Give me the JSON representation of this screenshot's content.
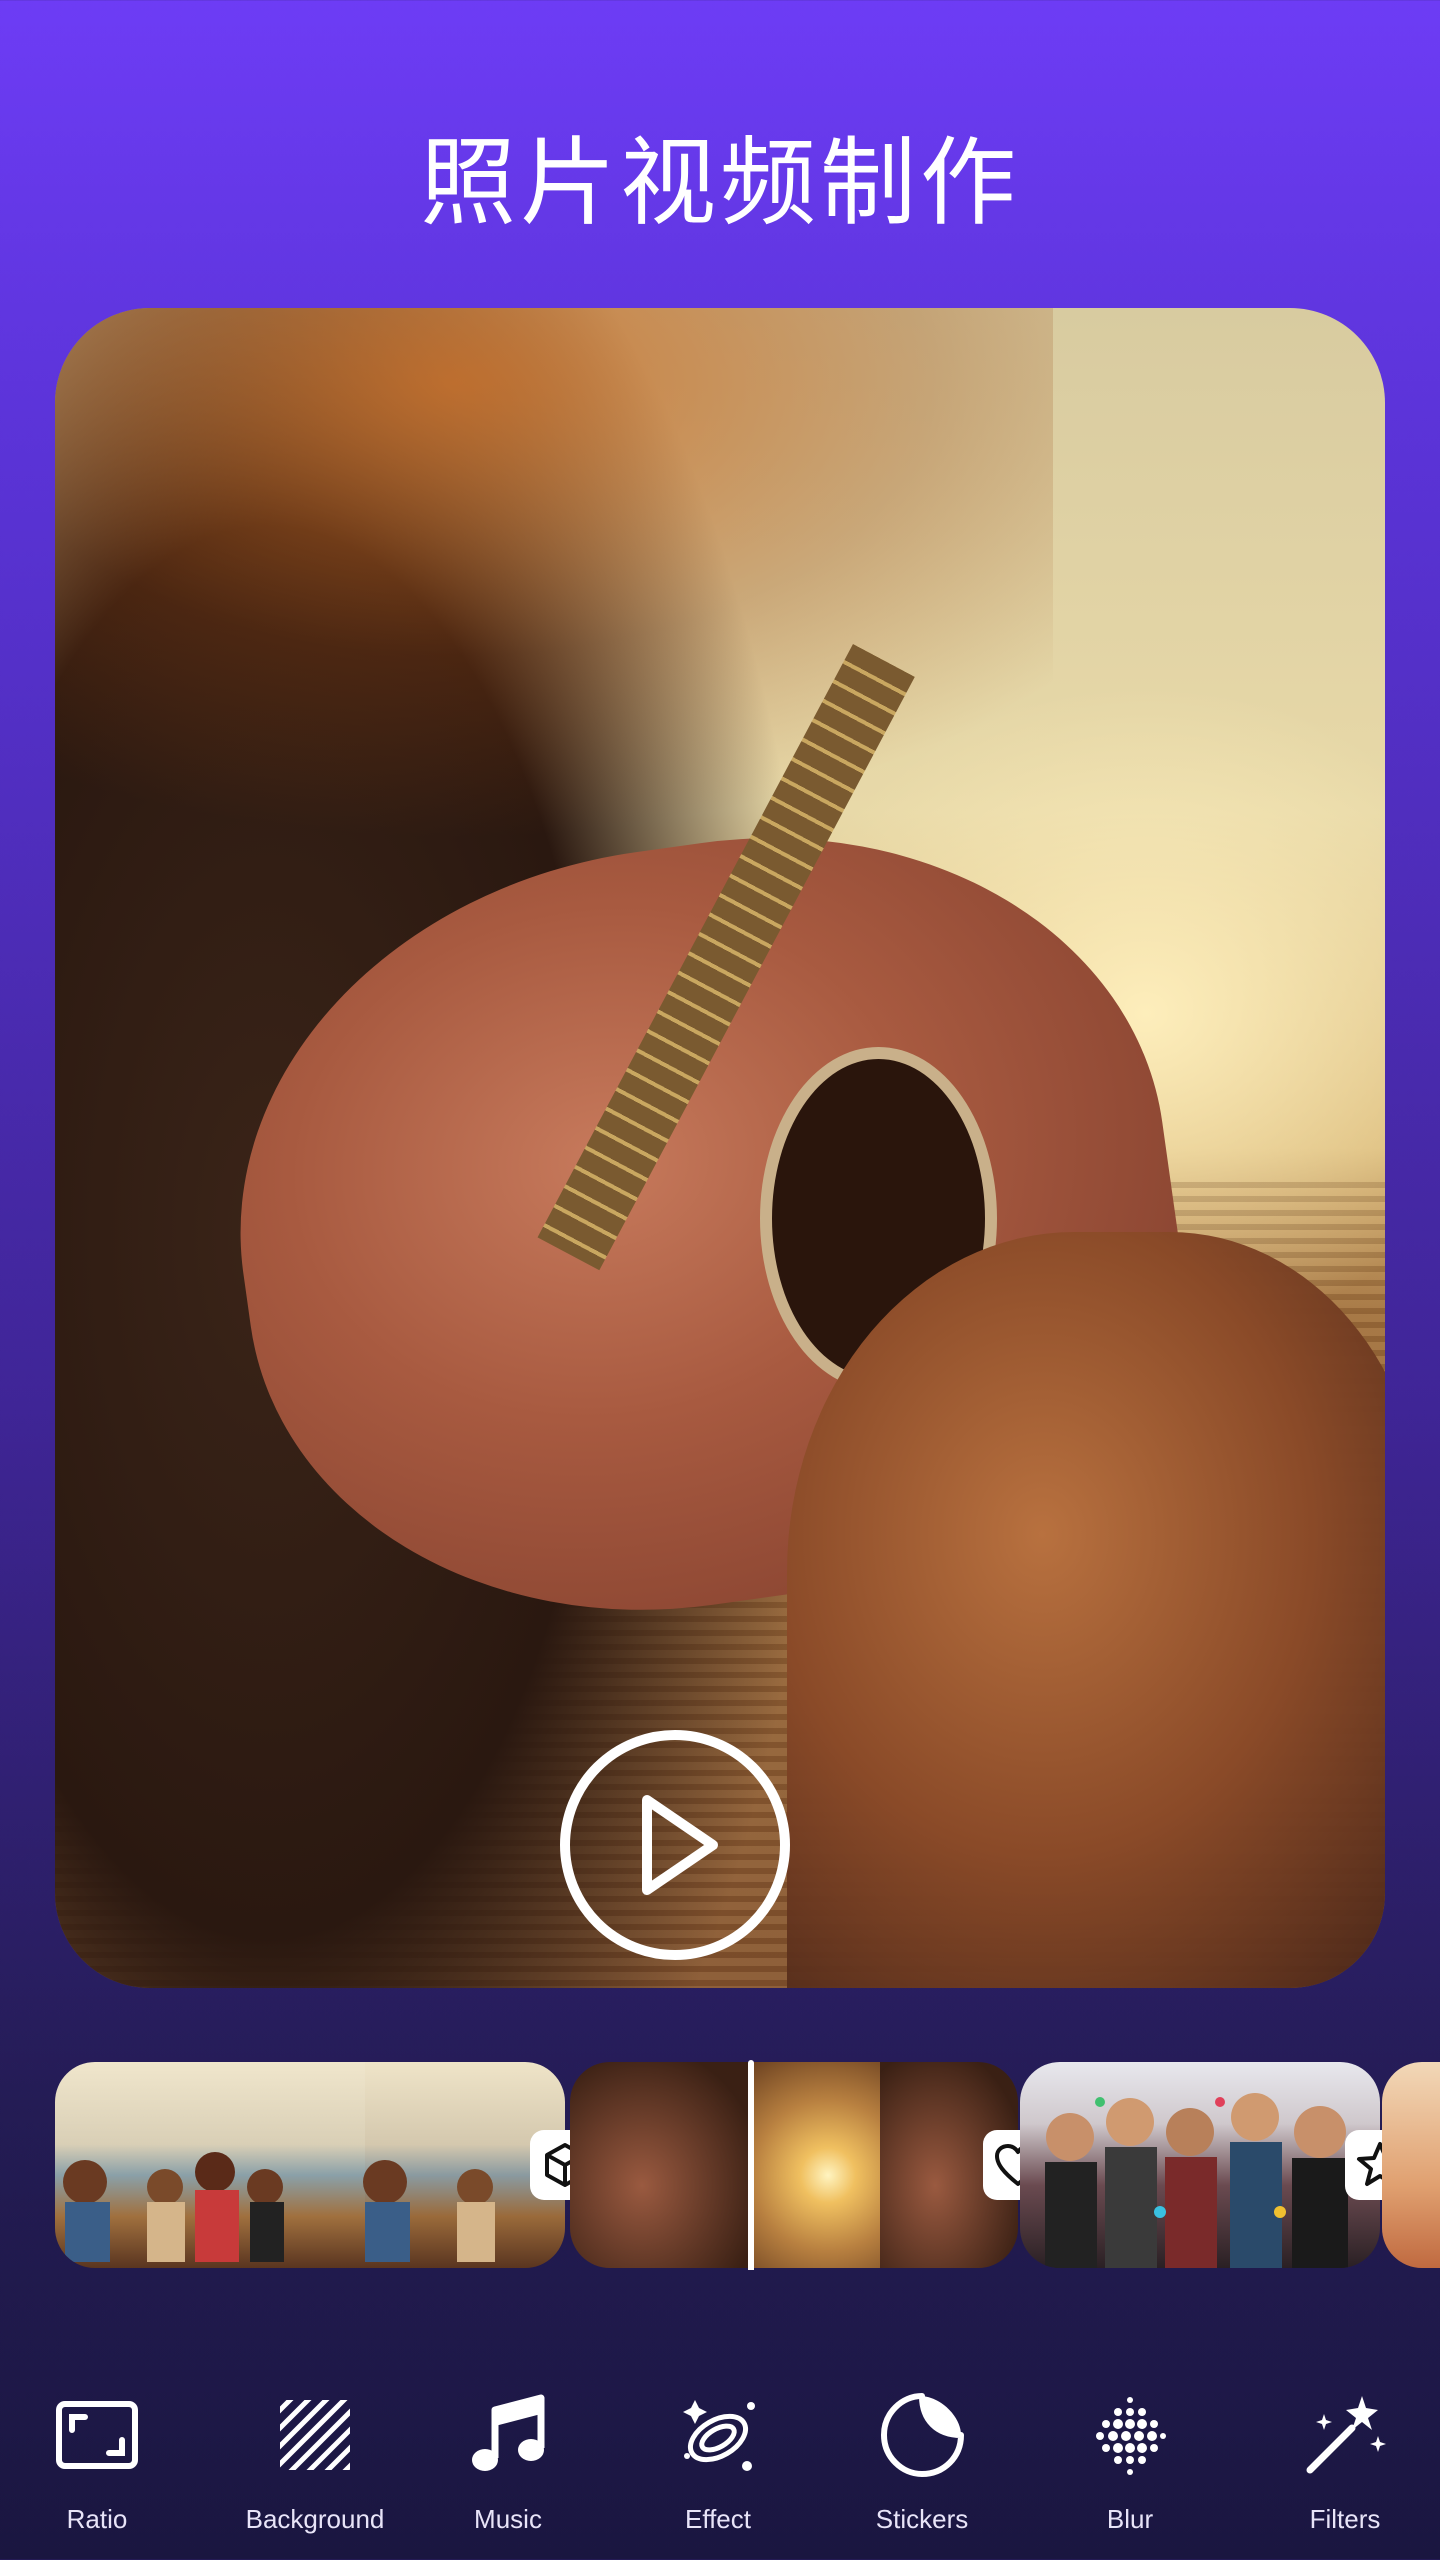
{
  "header": {
    "title": "照片视频制作"
  },
  "preview": {
    "play_label": "play"
  },
  "timeline": {
    "clips": [
      {
        "name": "beach-friends-clip",
        "transition": "cube-icon"
      },
      {
        "name": "guitar-sunset-clip",
        "transition": "heart-icon"
      },
      {
        "name": "party-confetti-clip",
        "transition": "star-icon"
      },
      {
        "name": "partial-clip"
      }
    ]
  },
  "toolbar": {
    "items": [
      {
        "label": "Ratio",
        "icon": "ratio-icon"
      },
      {
        "label": "Background",
        "icon": "background-icon"
      },
      {
        "label": "Music",
        "icon": "music-icon"
      },
      {
        "label": "Effect",
        "icon": "effect-icon"
      },
      {
        "label": "Stickers",
        "icon": "sticker-icon"
      },
      {
        "label": "Blur",
        "icon": "blur-icon"
      },
      {
        "label": "Filters",
        "icon": "magic-wand-icon"
      }
    ]
  },
  "colors": {
    "accent": "#6d3cf5",
    "bottom": "#1a1640"
  }
}
